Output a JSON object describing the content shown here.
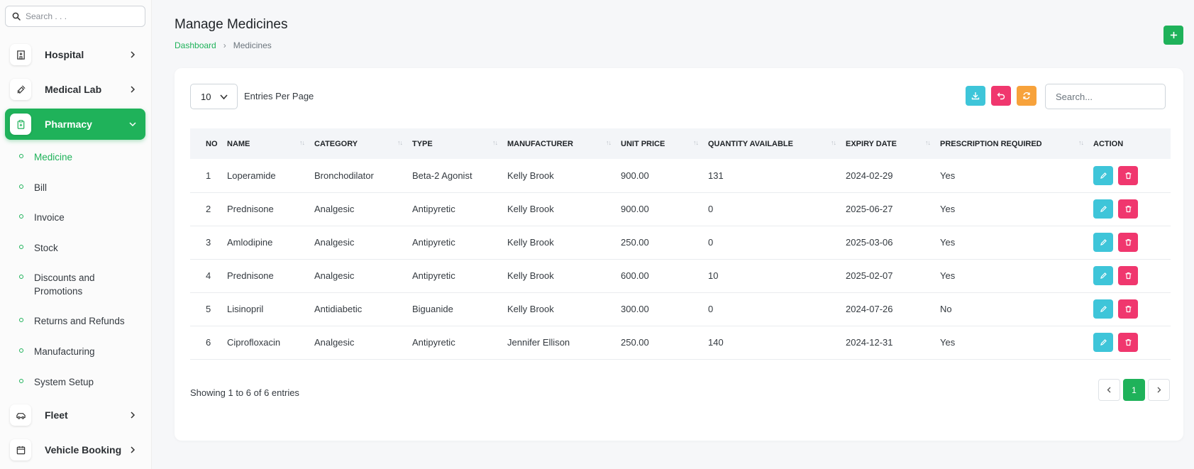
{
  "sidebar": {
    "search_placeholder": "Search . . .",
    "items": [
      {
        "label": "Hospital",
        "icon": "hospital-icon"
      },
      {
        "label": "Medical Lab",
        "icon": "syringe-icon"
      },
      {
        "label": "Pharmacy",
        "icon": "clipboard-icon",
        "active": true
      },
      {
        "label": "Fleet",
        "icon": "car-icon"
      },
      {
        "label": "Vehicle Booking",
        "icon": "calendar-icon"
      }
    ],
    "sub_items": [
      {
        "label": "Medicine",
        "active": true
      },
      {
        "label": "Bill"
      },
      {
        "label": "Invoice"
      },
      {
        "label": "Stock"
      },
      {
        "label": "Discounts and Promotions"
      },
      {
        "label": "Returns and Refunds"
      },
      {
        "label": "Manufacturing"
      },
      {
        "label": "System Setup"
      }
    ]
  },
  "header": {
    "title": "Manage Medicines",
    "breadcrumb": {
      "home": "Dashboard",
      "current": "Medicines"
    }
  },
  "table_controls": {
    "entries_value": "10",
    "entries_label": "Entries Per Page",
    "search_placeholder": "Search..."
  },
  "table": {
    "columns": [
      "NO",
      "NAME",
      "CATEGORY",
      "TYPE",
      "MANUFACTURER",
      "UNIT PRICE",
      "QUANTITY AVAILABLE",
      "EXPIRY DATE",
      "PRESCRIPTION REQUIRED",
      "ACTION"
    ],
    "rows": [
      [
        "1",
        "Loperamide",
        "Bronchodilator",
        "Beta-2 Agonist",
        "Kelly Brook",
        "900.00",
        "131",
        "2024-02-29",
        "Yes"
      ],
      [
        "2",
        "Prednisone",
        "Analgesic",
        "Antipyretic",
        "Kelly Brook",
        "900.00",
        "0",
        "2025-06-27",
        "Yes"
      ],
      [
        "3",
        "Amlodipine",
        "Analgesic",
        "Antipyretic",
        "Kelly Brook",
        "250.00",
        "0",
        "2025-03-06",
        "Yes"
      ],
      [
        "4",
        "Prednisone",
        "Analgesic",
        "Antipyretic",
        "Kelly Brook",
        "600.00",
        "10",
        "2025-02-07",
        "Yes"
      ],
      [
        "5",
        "Lisinopril",
        "Antidiabetic",
        "Biguanide",
        "Kelly Brook",
        "300.00",
        "0",
        "2024-07-26",
        "No"
      ],
      [
        "6",
        "Ciprofloxacin",
        "Analgesic",
        "Antipyretic",
        "Jennifer Ellison",
        "250.00",
        "140",
        "2024-12-31",
        "Yes"
      ]
    ]
  },
  "footer": {
    "showing": "Showing 1 to 6 of 6 entries",
    "current_page": "1"
  },
  "colors": {
    "primary": "#1fb25a",
    "edit": "#3ec5d9",
    "delete": "#f0376e",
    "refresh": "#f7a23b",
    "export": "#3ec5d9"
  }
}
